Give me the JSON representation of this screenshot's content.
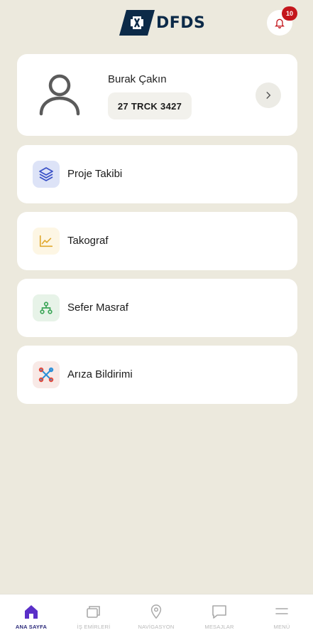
{
  "header": {
    "logo_text": "DFDS",
    "notification_count": "10",
    "brand_color": "#0c2a48",
    "badge_color": "#c4161c"
  },
  "profile": {
    "name": "Burak Çakın",
    "plate": "27 TRCK 3427"
  },
  "menu": [
    {
      "label": "Proje Takibi",
      "icon": "layers-icon",
      "color": "#3b52c7"
    },
    {
      "label": "Takograf",
      "icon": "line-chart-icon",
      "color": "#e0a82e"
    },
    {
      "label": "Sefer Masraf",
      "icon": "hierarchy-icon",
      "color": "#3aa556"
    },
    {
      "label": "Arıza Bildirimi",
      "icon": "tools-icon",
      "color": "#2a8fd8"
    }
  ],
  "tabs": [
    {
      "label": "ANA SAYFA",
      "icon": "home-icon",
      "active": true
    },
    {
      "label": "İŞ EMİRLERİ",
      "icon": "cards-icon",
      "active": false
    },
    {
      "label": "NAVİGASYON",
      "icon": "location-pin-icon",
      "active": false
    },
    {
      "label": "MESAJLAR",
      "icon": "chat-icon",
      "active": false
    },
    {
      "label": "MENÜ",
      "icon": "hamburger-icon",
      "active": false
    }
  ],
  "accent_color": "#5a2fc8"
}
